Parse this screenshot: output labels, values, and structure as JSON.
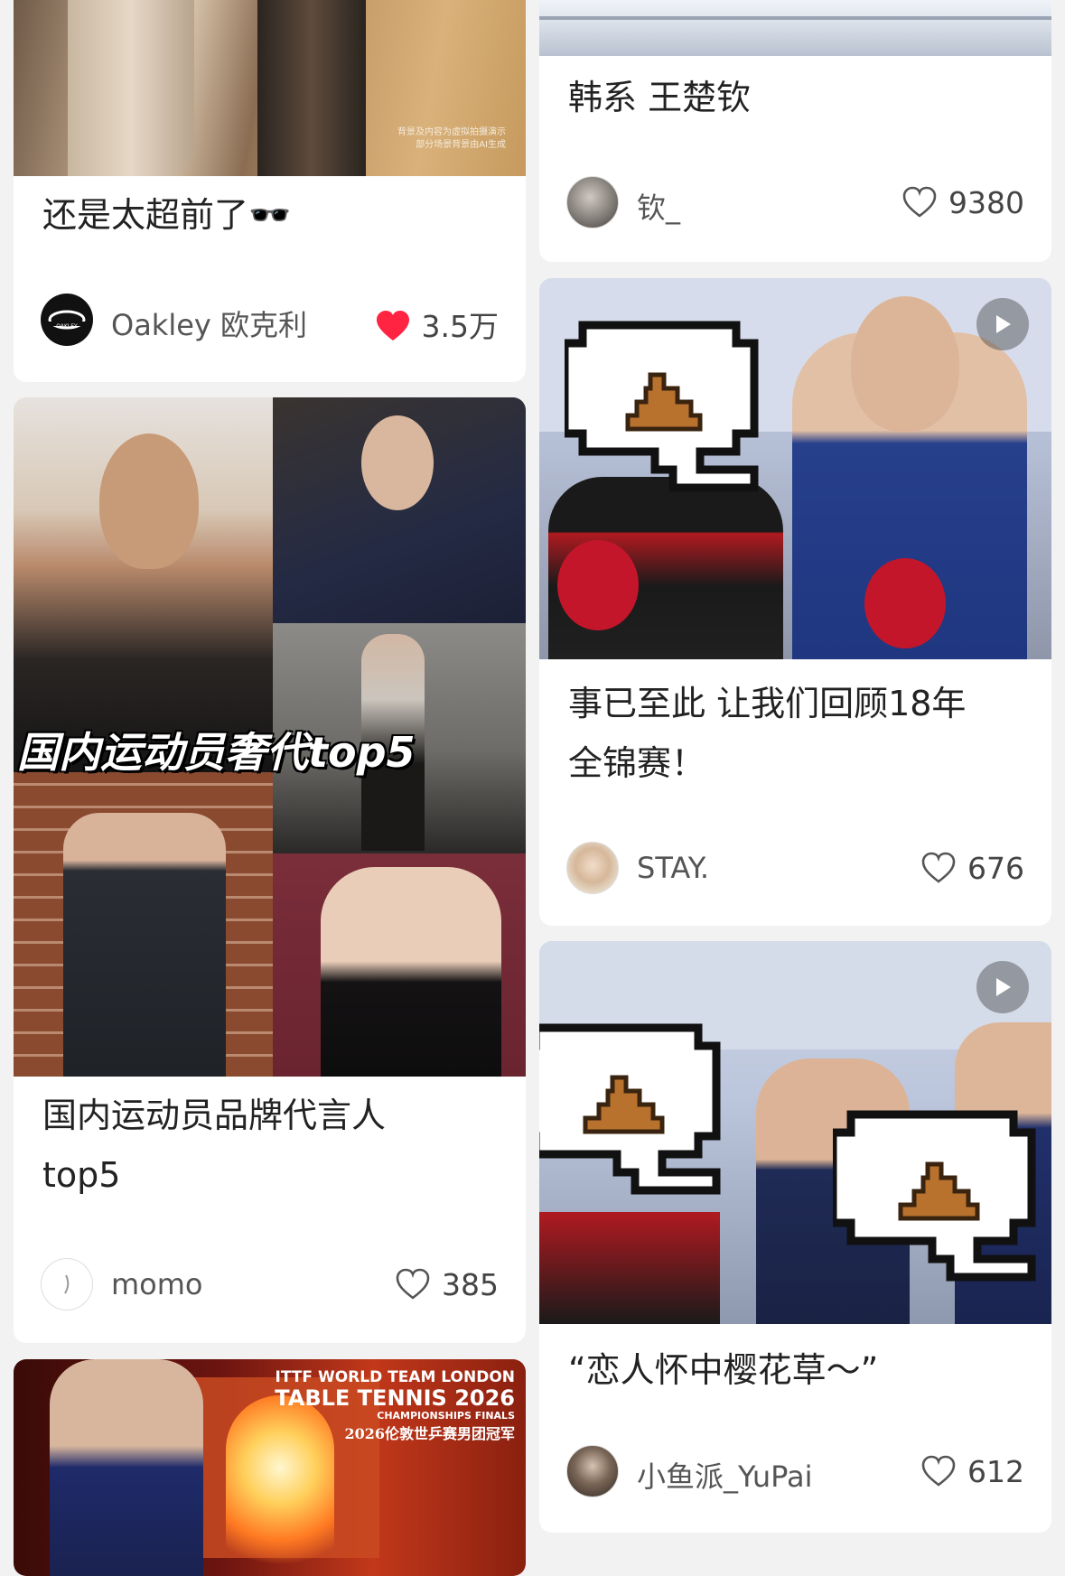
{
  "feed": {
    "cards": [
      {
        "title": "还是太超前了🕶️",
        "author": "Oakley 欧克利",
        "likes": "3.5万",
        "liked": true,
        "image_caption": "背景及内容为虚拟拍摄演示 部分场景背景由AI生成"
      },
      {
        "title_lines": [
          "国内运动员品牌代言人",
          "top5"
        ],
        "author": "momo",
        "likes": "385",
        "image_overlay": "国内运动员奢代top5"
      },
      {
        "image_overlay_lines": [
          "ITTF WORLD TEAM LONDON",
          "TABLE TENNIS 2026",
          "CHAMPIONSHIPS FINALS",
          "2026伦敦世乒赛男团冠军"
        ]
      },
      {
        "title": "韩系 王楚钦",
        "author": "钦_",
        "likes": "9380"
      },
      {
        "title_lines": [
          "事已至此 让我们回顾18年",
          "全锦赛！"
        ],
        "author": "STAY.",
        "likes": "676"
      },
      {
        "title": "“恋人怀中樱花草～”",
        "author": "小鱼派_YuPai",
        "likes": "612"
      }
    ]
  },
  "colors": {
    "like_red": "#ff2442",
    "page_bg": "#f2f2f2",
    "card_bg": "#ffffff"
  }
}
